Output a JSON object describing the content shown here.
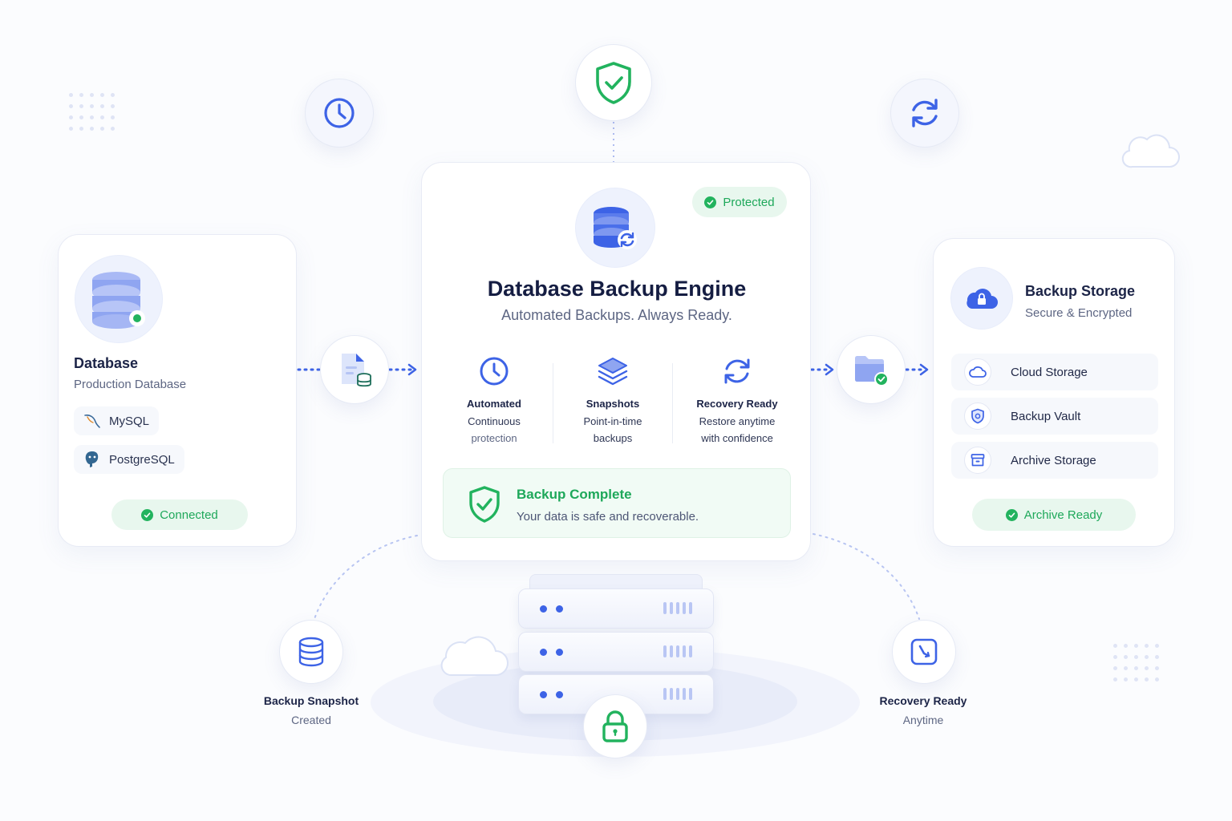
{
  "colors": {
    "primary_blue": "#3d63e6",
    "success_green": "#22b35e",
    "success_bg": "#e8f7ee",
    "text_dark": "#1c2447",
    "text_muted": "#5d6683"
  },
  "icons": {
    "top_left": "clock-icon",
    "top_center": "shield-check-icon",
    "top_right": "sync-icon",
    "cloud_decor": "cloud-icon"
  },
  "database": {
    "title": "Database",
    "subtitle": "Production Database",
    "engines": [
      {
        "label": "MySQL",
        "icon": "mysql-dolphin-icon"
      },
      {
        "label": "PostgreSQL",
        "icon": "postgresql-elephant-icon"
      }
    ],
    "status": "Connected"
  },
  "engine": {
    "badge": "Protected",
    "title": "Database Backup Engine",
    "tagline": "Automated Backups. Always Ready.",
    "features": [
      {
        "icon": "clock-icon",
        "title": "Automated",
        "line1": "Continuous",
        "line2": "protection"
      },
      {
        "icon": "layers-icon",
        "title": "Snapshots",
        "line1": "Point-in-time",
        "line2": "backups"
      },
      {
        "icon": "refresh-icon",
        "title": "Recovery Ready",
        "line1": "Restore anytime",
        "line2": "with confidence"
      }
    ],
    "complete_title": "Backup Complete",
    "complete_message": "Your data is safe and recoverable."
  },
  "storage": {
    "title": "Backup Storage",
    "subtitle": "Secure & Encrypted",
    "items": [
      {
        "label": "Cloud Storage",
        "icon": "cloud-icon"
      },
      {
        "label": "Backup Vault",
        "icon": "vault-shield-icon"
      },
      {
        "label": "Archive Storage",
        "icon": "archive-box-icon"
      }
    ],
    "status": "Archive Ready"
  },
  "bottom": {
    "snapshot_title": "Backup Snapshot",
    "snapshot_sub": "Created",
    "recovery_title": "Recovery Ready",
    "recovery_sub": "Anytime",
    "server_icon": "server-stack-icon",
    "lock_icon": "lock-icon"
  }
}
